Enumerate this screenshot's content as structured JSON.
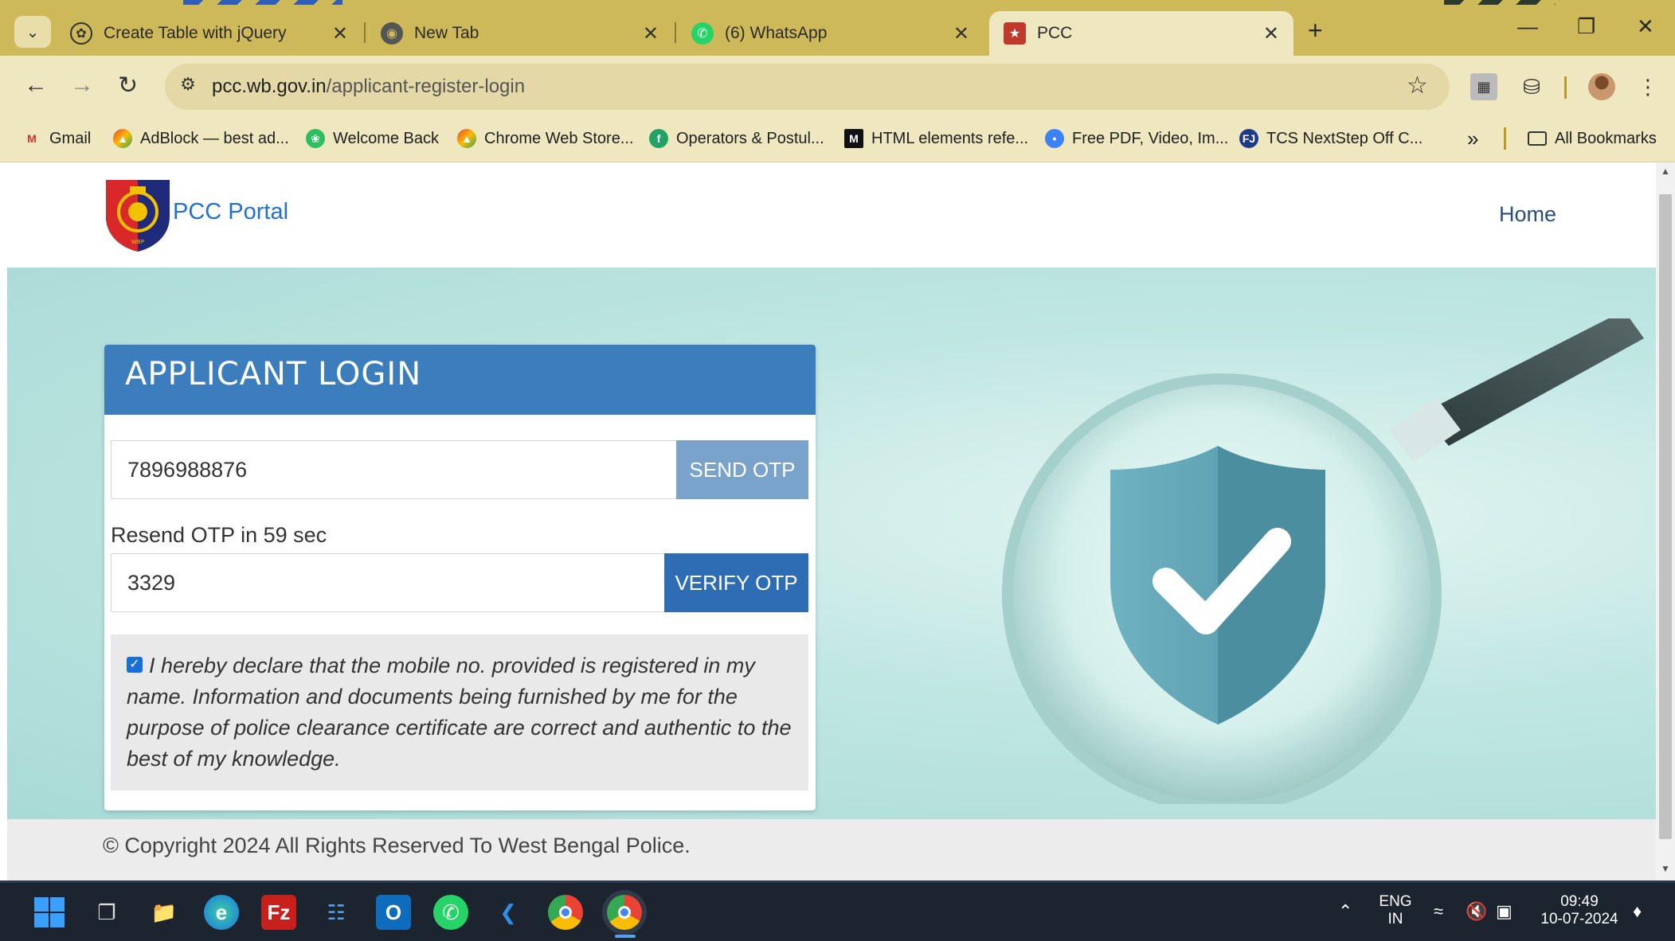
{
  "browser": {
    "tabs": [
      {
        "title": "Create Table with jQuery",
        "icon": "openai-icon"
      },
      {
        "title": "New Tab",
        "icon": "chrome-icon"
      },
      {
        "title": "(6) WhatsApp",
        "icon": "whatsapp-icon"
      },
      {
        "title": "PCC",
        "icon": "police-badge-icon",
        "active": true
      }
    ],
    "url_host": "pcc.wb.gov.in",
    "url_path": "/applicant-register-login",
    "bookmarks": [
      {
        "label": "Gmail",
        "icon": "gmail-icon"
      },
      {
        "label": "AdBlock — best ad...",
        "icon": "webstore-icon"
      },
      {
        "label": "Welcome Back",
        "icon": "evernote-icon"
      },
      {
        "label": "Chrome Web Store...",
        "icon": "webstore-icon"
      },
      {
        "label": "Operators & Postul...",
        "icon": "fs-icon"
      },
      {
        "label": "HTML elements refe...",
        "icon": "mdn-icon"
      },
      {
        "label": "Free PDF, Video, Im...",
        "icon": "pdf-icon"
      },
      {
        "label": "TCS NextStep Off C...",
        "icon": "tcs-icon"
      }
    ],
    "all_bookmarks": "All Bookmarks"
  },
  "site": {
    "brand": "PCC Portal",
    "nav_home": "Home"
  },
  "login": {
    "title": "APPLICANT LOGIN",
    "mobile_value": "7896988876",
    "send_otp": "SEND OTP",
    "resend_text": "Resend OTP in 59 sec",
    "otp_value": "3329",
    "verify_otp": "VERIFY OTP",
    "declaration_checked": true,
    "declaration": "I hereby declare that the mobile no. provided is registered in my name. Information and documents being furnished by me for the purpose of police clearance certificate are correct and authentic to the best of my knowledge."
  },
  "footer": {
    "copyright": "© Copyright 2024 All Rights Reserved To West Bengal Police."
  },
  "taskbar": {
    "lang_top": "ENG",
    "lang_bottom": "IN",
    "time": "09:49",
    "date": "10-07-2024"
  },
  "colors": {
    "tabstrip": "#cdb85a",
    "toolbar": "#efe7bf",
    "card_header": "#3b7dbd",
    "send_btn": "#7aa3cc",
    "verify_btn": "#2e6cb3",
    "brand_link": "#1e6fd9"
  }
}
